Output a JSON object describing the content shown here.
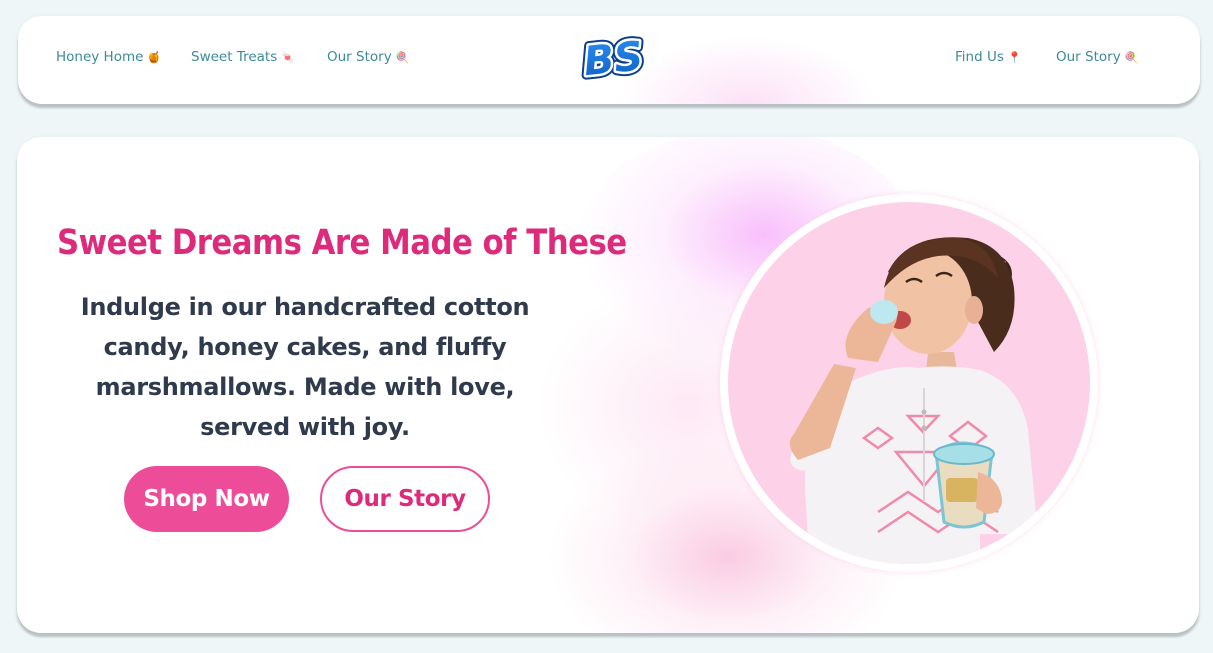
{
  "nav": {
    "left_links": [
      {
        "label": "Honey Home",
        "emoji": "🍯"
      },
      {
        "label": "Sweet Treats",
        "emoji": "🍬"
      },
      {
        "label": "Our Story",
        "emoji": "🍭"
      }
    ],
    "right_links": [
      {
        "label": "Find Us",
        "emoji": "📍"
      },
      {
        "label": "Our Story",
        "emoji": "🍭"
      }
    ],
    "logo_text": "BS"
  },
  "hero": {
    "title": "Sweet Dreams Are Made of These",
    "description": "Indulge in our handcrafted cotton candy, honey cakes, and fluffy marshmallows. Made with love, served with joy.",
    "primary_button": "Shop Now",
    "secondary_button": "Our Story"
  },
  "colors": {
    "page_background": "#eef6f8",
    "accent_pink": "#ec4c98",
    "title_pink": "#de2a7a",
    "nav_link_teal": "#3d8a9c",
    "body_text": "#2f3a4c",
    "photo_circle_background": "#fdd2e8",
    "logo_blue": "#1a6fd6"
  },
  "icons": {
    "honey_home": "honey-pot-icon",
    "sweet_treats": "candy-icon",
    "our_story": "lollipop-icon",
    "find_us": "map-pin-icon"
  }
}
